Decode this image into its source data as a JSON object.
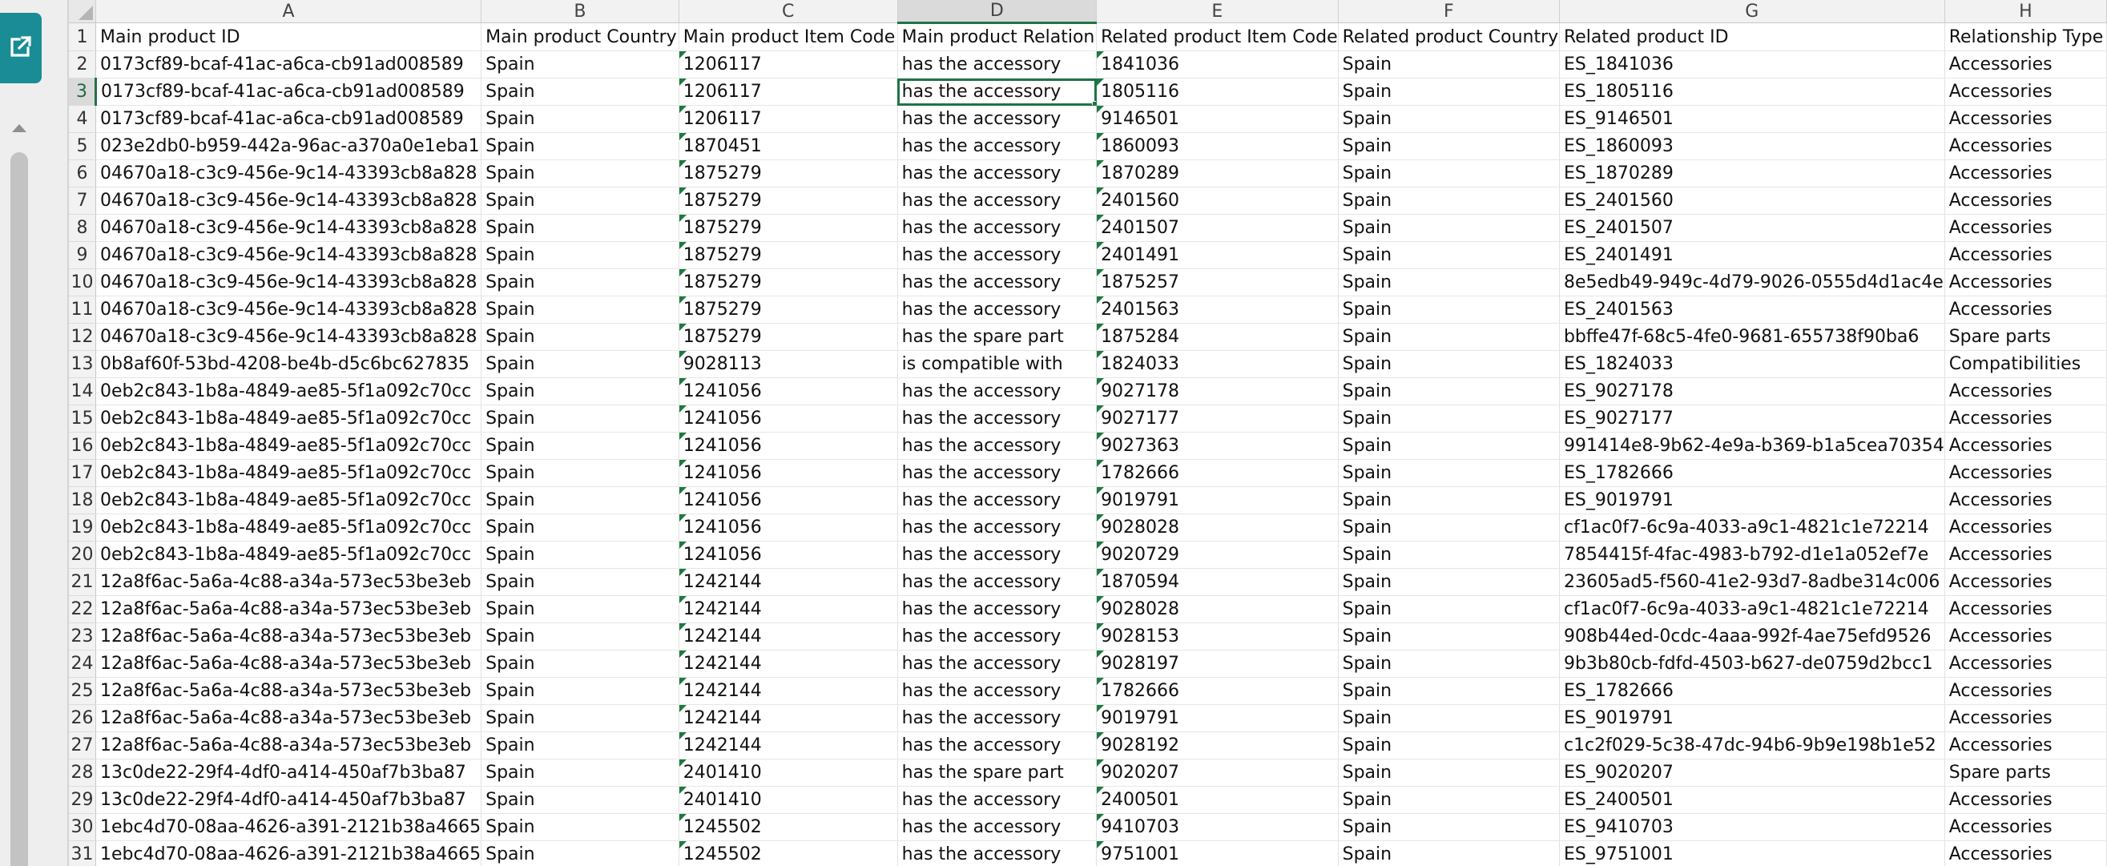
{
  "columns": [
    "A",
    "B",
    "C",
    "D",
    "E",
    "F",
    "G",
    "H"
  ],
  "selected_column": "D",
  "selected_row": 3,
  "active_cell": {
    "row": 3,
    "col": "D"
  },
  "headers": [
    "Main product ID",
    "Main product Country",
    "Main product Item Code",
    "Main product Relation",
    "Related product Item Code",
    "Related product Country",
    "Related product ID",
    "Relationship Type"
  ],
  "rows": [
    {
      "n": "2",
      "a": "0173cf89-bcaf-41ac-a6ca-cb91ad008589",
      "b": "Spain",
      "c": "1206117",
      "d": "has the accessory",
      "e": "1841036",
      "f": "Spain",
      "g": "ES_1841036",
      "h": "Accessories"
    },
    {
      "n": "3",
      "a": "0173cf89-bcaf-41ac-a6ca-cb91ad008589",
      "b": "Spain",
      "c": "1206117",
      "d": "has the accessory",
      "e": "1805116",
      "f": "Spain",
      "g": "ES_1805116",
      "h": "Accessories"
    },
    {
      "n": "4",
      "a": "0173cf89-bcaf-41ac-a6ca-cb91ad008589",
      "b": "Spain",
      "c": "1206117",
      "d": "has the accessory",
      "e": "9146501",
      "f": "Spain",
      "g": "ES_9146501",
      "h": "Accessories"
    },
    {
      "n": "5",
      "a": "023e2db0-b959-442a-96ac-a370a0e1eba1",
      "b": "Spain",
      "c": "1870451",
      "d": "has the accessory",
      "e": "1860093",
      "f": "Spain",
      "g": "ES_1860093",
      "h": "Accessories"
    },
    {
      "n": "6",
      "a": "04670a18-c3c9-456e-9c14-43393cb8a828",
      "b": "Spain",
      "c": "1875279",
      "d": "has the accessory",
      "e": "1870289",
      "f": "Spain",
      "g": "ES_1870289",
      "h": "Accessories"
    },
    {
      "n": "7",
      "a": "04670a18-c3c9-456e-9c14-43393cb8a828",
      "b": "Spain",
      "c": "1875279",
      "d": "has the accessory",
      "e": "2401560",
      "f": "Spain",
      "g": "ES_2401560",
      "h": "Accessories"
    },
    {
      "n": "8",
      "a": "04670a18-c3c9-456e-9c14-43393cb8a828",
      "b": "Spain",
      "c": "1875279",
      "d": "has the accessory",
      "e": "2401507",
      "f": "Spain",
      "g": "ES_2401507",
      "h": "Accessories"
    },
    {
      "n": "9",
      "a": "04670a18-c3c9-456e-9c14-43393cb8a828",
      "b": "Spain",
      "c": "1875279",
      "d": "has the accessory",
      "e": "2401491",
      "f": "Spain",
      "g": "ES_2401491",
      "h": "Accessories"
    },
    {
      "n": "10",
      "a": "04670a18-c3c9-456e-9c14-43393cb8a828",
      "b": "Spain",
      "c": "1875279",
      "d": "has the accessory",
      "e": "1875257",
      "f": "Spain",
      "g": "8e5edb49-949c-4d79-9026-0555d4d1ac4e",
      "h": "Accessories"
    },
    {
      "n": "11",
      "a": "04670a18-c3c9-456e-9c14-43393cb8a828",
      "b": "Spain",
      "c": "1875279",
      "d": "has the accessory",
      "e": "2401563",
      "f": "Spain",
      "g": "ES_2401563",
      "h": "Accessories"
    },
    {
      "n": "12",
      "a": "04670a18-c3c9-456e-9c14-43393cb8a828",
      "b": "Spain",
      "c": "1875279",
      "d": "has the spare part",
      "e": "1875284",
      "f": "Spain",
      "g": "bbffe47f-68c5-4fe0-9681-655738f90ba6",
      "h": "Spare parts"
    },
    {
      "n": "13",
      "a": "0b8af60f-53bd-4208-be4b-d5c6bc627835",
      "b": "Spain",
      "c": "9028113",
      "d": "is compatible with",
      "e": "1824033",
      "f": "Spain",
      "g": "ES_1824033",
      "h": "Compatibilities"
    },
    {
      "n": "14",
      "a": "0eb2c843-1b8a-4849-ae85-5f1a092c70cc",
      "b": "Spain",
      "c": "1241056",
      "d": "has the accessory",
      "e": "9027178",
      "f": "Spain",
      "g": "ES_9027178",
      "h": "Accessories"
    },
    {
      "n": "15",
      "a": "0eb2c843-1b8a-4849-ae85-5f1a092c70cc",
      "b": "Spain",
      "c": "1241056",
      "d": "has the accessory",
      "e": "9027177",
      "f": "Spain",
      "g": "ES_9027177",
      "h": "Accessories"
    },
    {
      "n": "16",
      "a": "0eb2c843-1b8a-4849-ae85-5f1a092c70cc",
      "b": "Spain",
      "c": "1241056",
      "d": "has the accessory",
      "e": "9027363",
      "f": "Spain",
      "g": "991414e8-9b62-4e9a-b369-b1a5cea70354",
      "h": "Accessories"
    },
    {
      "n": "17",
      "a": "0eb2c843-1b8a-4849-ae85-5f1a092c70cc",
      "b": "Spain",
      "c": "1241056",
      "d": "has the accessory",
      "e": "1782666",
      "f": "Spain",
      "g": "ES_1782666",
      "h": "Accessories"
    },
    {
      "n": "18",
      "a": "0eb2c843-1b8a-4849-ae85-5f1a092c70cc",
      "b": "Spain",
      "c": "1241056",
      "d": "has the accessory",
      "e": "9019791",
      "f": "Spain",
      "g": "ES_9019791",
      "h": "Accessories"
    },
    {
      "n": "19",
      "a": "0eb2c843-1b8a-4849-ae85-5f1a092c70cc",
      "b": "Spain",
      "c": "1241056",
      "d": "has the accessory",
      "e": "9028028",
      "f": "Spain",
      "g": "cf1ac0f7-6c9a-4033-a9c1-4821c1e72214",
      "h": "Accessories"
    },
    {
      "n": "20",
      "a": "0eb2c843-1b8a-4849-ae85-5f1a092c70cc",
      "b": "Spain",
      "c": "1241056",
      "d": "has the accessory",
      "e": "9020729",
      "f": "Spain",
      "g": "7854415f-4fac-4983-b792-d1e1a052ef7e",
      "h": "Accessories"
    },
    {
      "n": "21",
      "a": "12a8f6ac-5a6a-4c88-a34a-573ec53be3eb",
      "b": "Spain",
      "c": "1242144",
      "d": "has the accessory",
      "e": "1870594",
      "f": "Spain",
      "g": "23605ad5-f560-41e2-93d7-8adbe314c006",
      "h": "Accessories"
    },
    {
      "n": "22",
      "a": "12a8f6ac-5a6a-4c88-a34a-573ec53be3eb",
      "b": "Spain",
      "c": "1242144",
      "d": "has the accessory",
      "e": "9028028",
      "f": "Spain",
      "g": "cf1ac0f7-6c9a-4033-a9c1-4821c1e72214",
      "h": "Accessories"
    },
    {
      "n": "23",
      "a": "12a8f6ac-5a6a-4c88-a34a-573ec53be3eb",
      "b": "Spain",
      "c": "1242144",
      "d": "has the accessory",
      "e": "9028153",
      "f": "Spain",
      "g": "908b44ed-0cdc-4aaa-992f-4ae75efd9526",
      "h": "Accessories"
    },
    {
      "n": "24",
      "a": "12a8f6ac-5a6a-4c88-a34a-573ec53be3eb",
      "b": "Spain",
      "c": "1242144",
      "d": "has the accessory",
      "e": "9028197",
      "f": "Spain",
      "g": "9b3b80cb-fdfd-4503-b627-de0759d2bcc1",
      "h": "Accessories"
    },
    {
      "n": "25",
      "a": "12a8f6ac-5a6a-4c88-a34a-573ec53be3eb",
      "b": "Spain",
      "c": "1242144",
      "d": "has the accessory",
      "e": "1782666",
      "f": "Spain",
      "g": "ES_1782666",
      "h": "Accessories"
    },
    {
      "n": "26",
      "a": "12a8f6ac-5a6a-4c88-a34a-573ec53be3eb",
      "b": "Spain",
      "c": "1242144",
      "d": "has the accessory",
      "e": "9019791",
      "f": "Spain",
      "g": "ES_9019791",
      "h": "Accessories"
    },
    {
      "n": "27",
      "a": "12a8f6ac-5a6a-4c88-a34a-573ec53be3eb",
      "b": "Spain",
      "c": "1242144",
      "d": "has the accessory",
      "e": "9028192",
      "f": "Spain",
      "g": "c1c2f029-5c38-47dc-94b6-9b9e198b1e52",
      "h": "Accessories"
    },
    {
      "n": "28",
      "a": "13c0de22-29f4-4df0-a414-450af7b3ba87",
      "b": "Spain",
      "c": "2401410",
      "d": "has the spare part",
      "e": "9020207",
      "f": "Spain",
      "g": "ES_9020207",
      "h": "Spare parts"
    },
    {
      "n": "29",
      "a": "13c0de22-29f4-4df0-a414-450af7b3ba87",
      "b": "Spain",
      "c": "2401410",
      "d": "has the accessory",
      "e": "2400501",
      "f": "Spain",
      "g": "ES_2400501",
      "h": "Accessories"
    },
    {
      "n": "30",
      "a": "1ebc4d70-08aa-4626-a391-2121b38a4665",
      "b": "Spain",
      "c": "1245502",
      "d": "has the accessory",
      "e": "9410703",
      "f": "Spain",
      "g": "ES_9410703",
      "h": "Accessories"
    },
    {
      "n": "31",
      "a": "1ebc4d70-08aa-4626-a391-2121b38a4665",
      "b": "Spain",
      "c": "1245502",
      "d": "has the accessory",
      "e": "9751001",
      "f": "Spain",
      "g": "ES_9751001",
      "h": "Accessories"
    }
  ],
  "icons": {
    "expand": "open-in-new-icon",
    "scroll_up": "caret-up-icon",
    "select_all": "select-all-triangle-icon"
  },
  "colors": {
    "expand_button": "#1a8c96",
    "selection": "#217346",
    "number_as_text_marker": "#1d7a3e"
  }
}
